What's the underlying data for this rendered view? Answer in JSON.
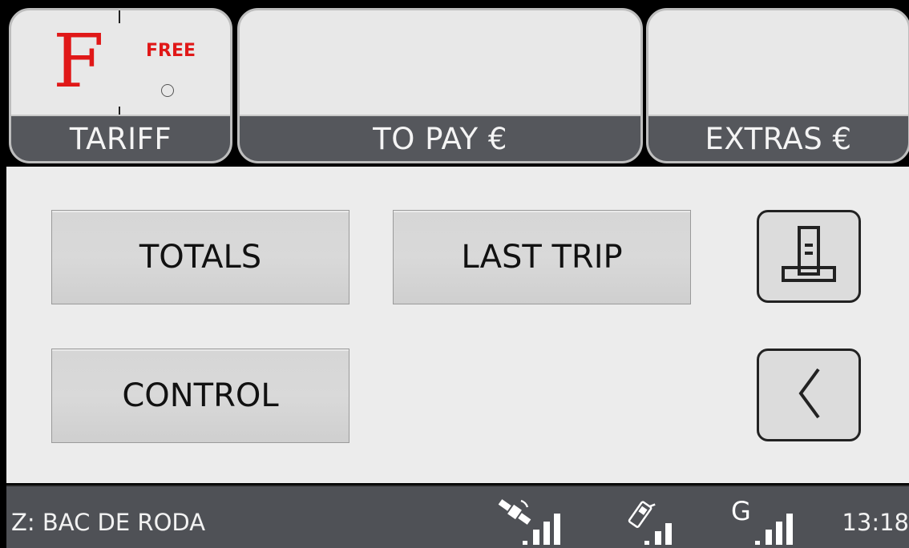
{
  "top_panels": {
    "tariff": {
      "letter": "F",
      "status": "FREE",
      "caption": "TARIFF"
    },
    "to_pay": {
      "caption": "TO PAY €"
    },
    "extras": {
      "caption": "EXTRAS €"
    }
  },
  "menu": {
    "totals_label": "TOTALS",
    "last_trip_label": "LAST TRIP",
    "control_label": "CONTROL"
  },
  "side_buttons": {
    "print_icon": "printer-icon",
    "back_icon": "chevron-left-icon"
  },
  "status_bar": {
    "zone": "Z: BAC DE RODA",
    "gps_icon": "satellite-icon",
    "phone_icon": "mobile-phone-icon",
    "gprs_letter": "G",
    "time": "13:18"
  },
  "colors": {
    "accent_red": "#e01818",
    "caption_bg": "#55575c",
    "status_bg": "#4f5156"
  }
}
